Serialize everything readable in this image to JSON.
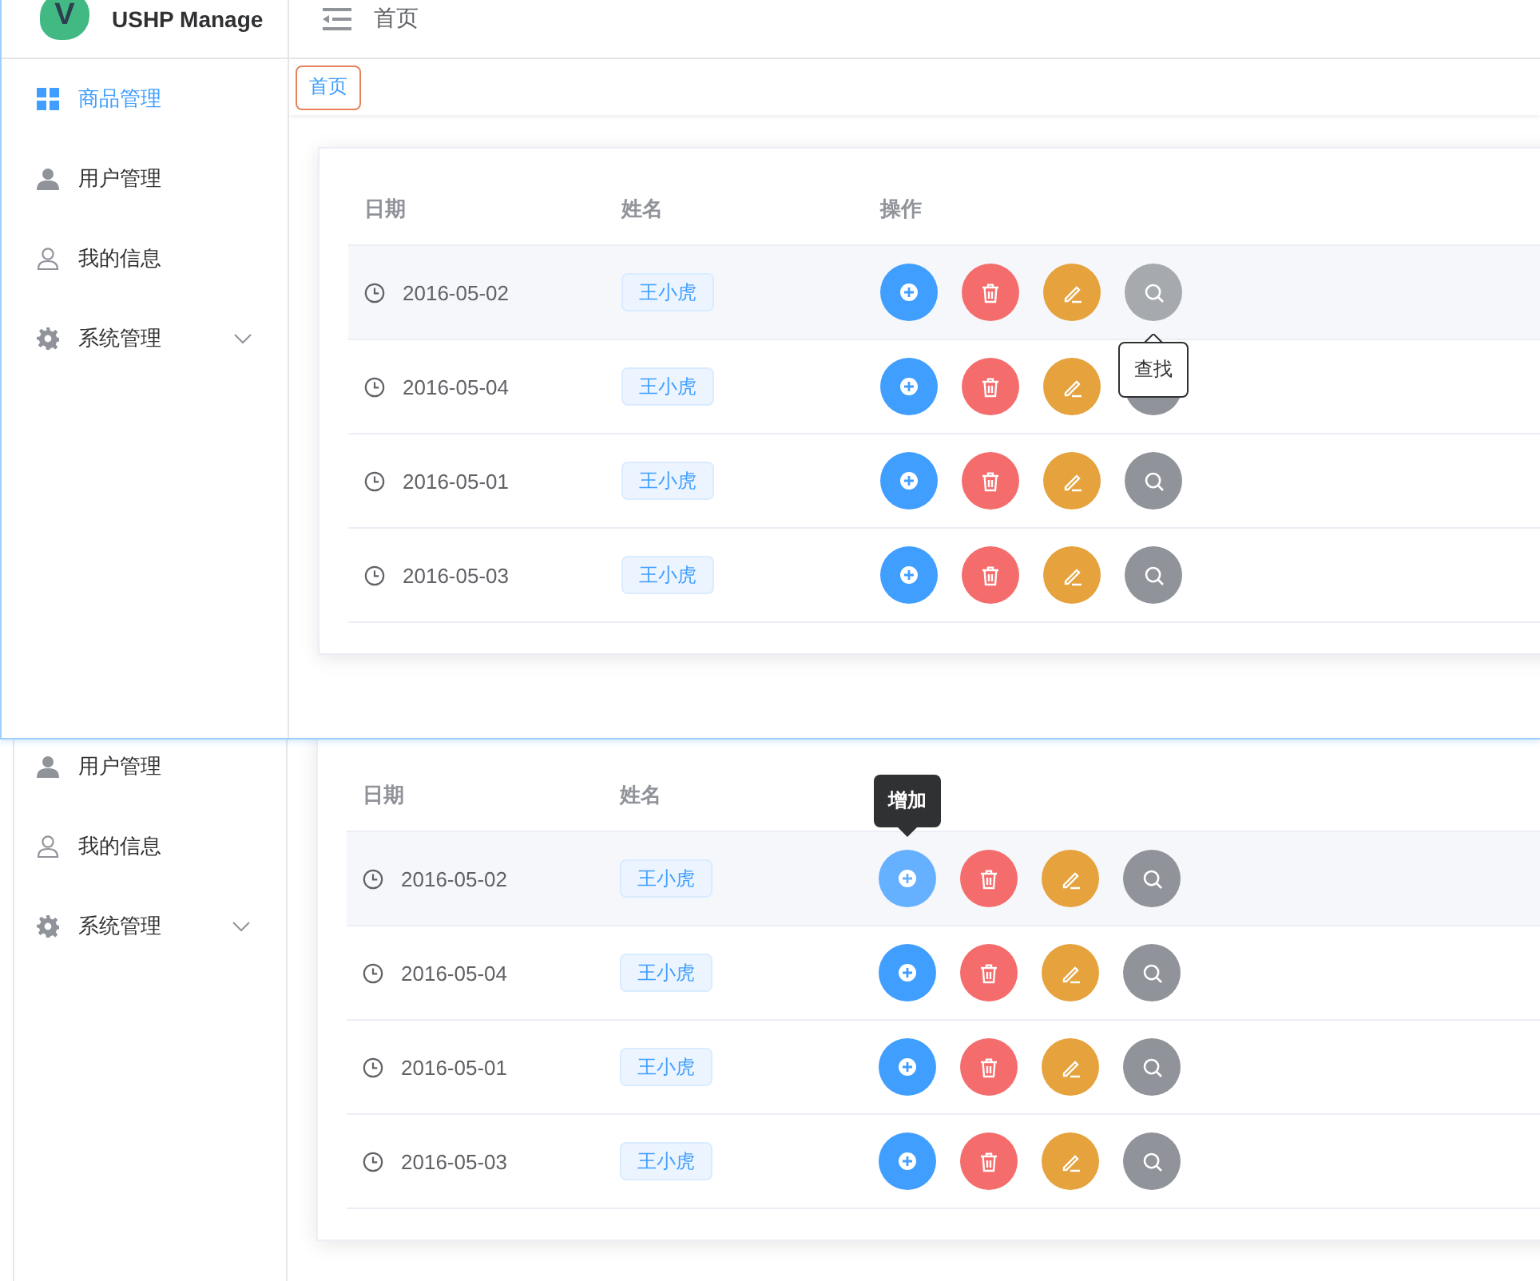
{
  "screens": [
    {
      "header": {
        "logo_letter": "V",
        "app_name": "USHP Manage",
        "breadcrumb": "首页"
      },
      "tabs": [
        {
          "label": "首页",
          "selected": true
        }
      ],
      "sidebar": {
        "items": [
          {
            "label": "商品管理",
            "selected": true
          },
          {
            "label": "用户管理",
            "selected": false
          },
          {
            "label": "我的信息",
            "selected": false
          },
          {
            "label": "系统管理",
            "selected": false,
            "expanded": false
          }
        ]
      },
      "table": {
        "columns": [
          "日期",
          "姓名",
          "操作"
        ],
        "rows": [
          {
            "date": "2016-05-02",
            "name": "王小虎",
            "actions": [
              {
                "hovered": false
              },
              {
                "hovered": false
              },
              {
                "hovered": false
              },
              {
                "hovered": true,
                "tooltip": {
                  "text": "查找",
                  "light": true
                }
              }
            ]
          },
          {
            "date": "2016-05-04",
            "name": "王小虎",
            "actions": [
              {
                "hovered": false
              },
              {
                "hovered": false
              },
              {
                "hovered": false
              },
              {
                "hovered": false
              }
            ]
          },
          {
            "date": "2016-05-01",
            "name": "王小虎",
            "actions": [
              {
                "hovered": false
              },
              {
                "hovered": false
              },
              {
                "hovered": false
              },
              {
                "hovered": false
              }
            ]
          },
          {
            "date": "2016-05-03",
            "name": "王小虎",
            "actions": [
              {
                "hovered": false
              },
              {
                "hovered": false
              },
              {
                "hovered": false
              },
              {
                "hovered": false
              }
            ]
          }
        ]
      }
    },
    {
      "sidebar": {
        "items": [
          {
            "label": "用户管理",
            "selected": false
          },
          {
            "label": "我的信息",
            "selected": false
          },
          {
            "label": "系统管理",
            "selected": false,
            "expanded": false
          }
        ]
      },
      "table": {
        "columns": [
          "日期",
          "姓名"
        ],
        "rows": [
          {
            "date": "2016-05-02",
            "name": "王小虎",
            "actions": [
              {
                "hovered": true,
                "tooltip": {
                  "text": "增加",
                  "light": false
                }
              },
              {
                "hovered": false
              },
              {
                "hovered": false
              },
              {
                "hovered": false
              }
            ]
          },
          {
            "date": "2016-05-04",
            "name": "王小虎",
            "actions": [
              {
                "hovered": false
              },
              {
                "hovered": false
              },
              {
                "hovered": false
              },
              {
                "hovered": false
              }
            ]
          },
          {
            "date": "2016-05-01",
            "name": "王小虎",
            "actions": [
              {
                "hovered": false
              },
              {
                "hovered": false
              },
              {
                "hovered": false
              },
              {
                "hovered": false
              }
            ]
          },
          {
            "date": "2016-05-03",
            "name": "王小虎",
            "actions": [
              {
                "hovered": false
              },
              {
                "hovered": false
              },
              {
                "hovered": false
              },
              {
                "hovered": false
              }
            ]
          }
        ]
      }
    }
  ]
}
